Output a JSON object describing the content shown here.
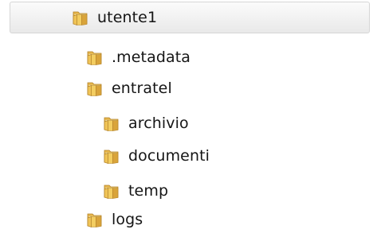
{
  "tree": {
    "root": {
      "label": "utente1",
      "icon": "folder-icon",
      "selected": true
    },
    "items": [
      {
        "label": ".metadata",
        "icon": "folder-icon"
      },
      {
        "label": "entratel",
        "icon": "folder-icon"
      },
      {
        "label": "archivio",
        "icon": "folder-icon"
      },
      {
        "label": "documenti",
        "icon": "folder-icon"
      },
      {
        "label": "temp",
        "icon": "folder-icon"
      },
      {
        "label": "logs",
        "icon": "folder-icon"
      }
    ]
  }
}
